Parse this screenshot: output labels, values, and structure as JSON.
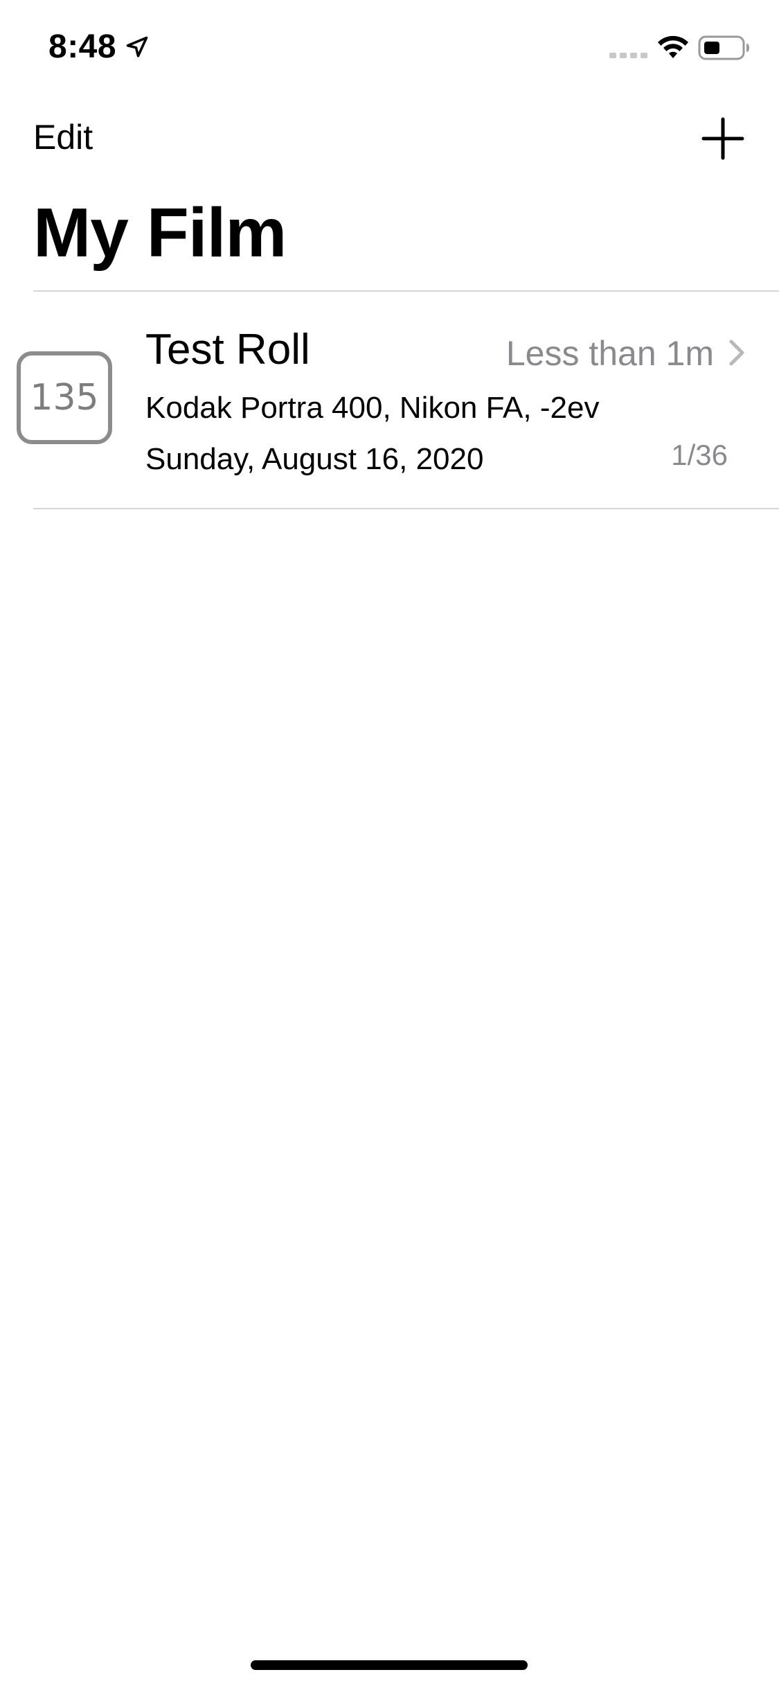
{
  "status_bar": {
    "time": "8:48",
    "icons": [
      "location-arrow-icon",
      "cellular-signal-icon",
      "wifi-icon",
      "battery-icon"
    ]
  },
  "nav": {
    "edit_label": "Edit",
    "add_icon": "plus-icon"
  },
  "page": {
    "title": "My Film"
  },
  "rolls": [
    {
      "format": "135",
      "title": "Test Roll",
      "elapsed": "Less than 1m",
      "subtitle": "Kodak Portra 400, Nikon FA, -2ev",
      "date": "Sunday, August 16, 2020",
      "count": "1/36"
    }
  ],
  "colors": {
    "secondary_text": "#8a8a8e",
    "badge_border": "#8c8c8c",
    "separator": "#d6d6d8"
  }
}
